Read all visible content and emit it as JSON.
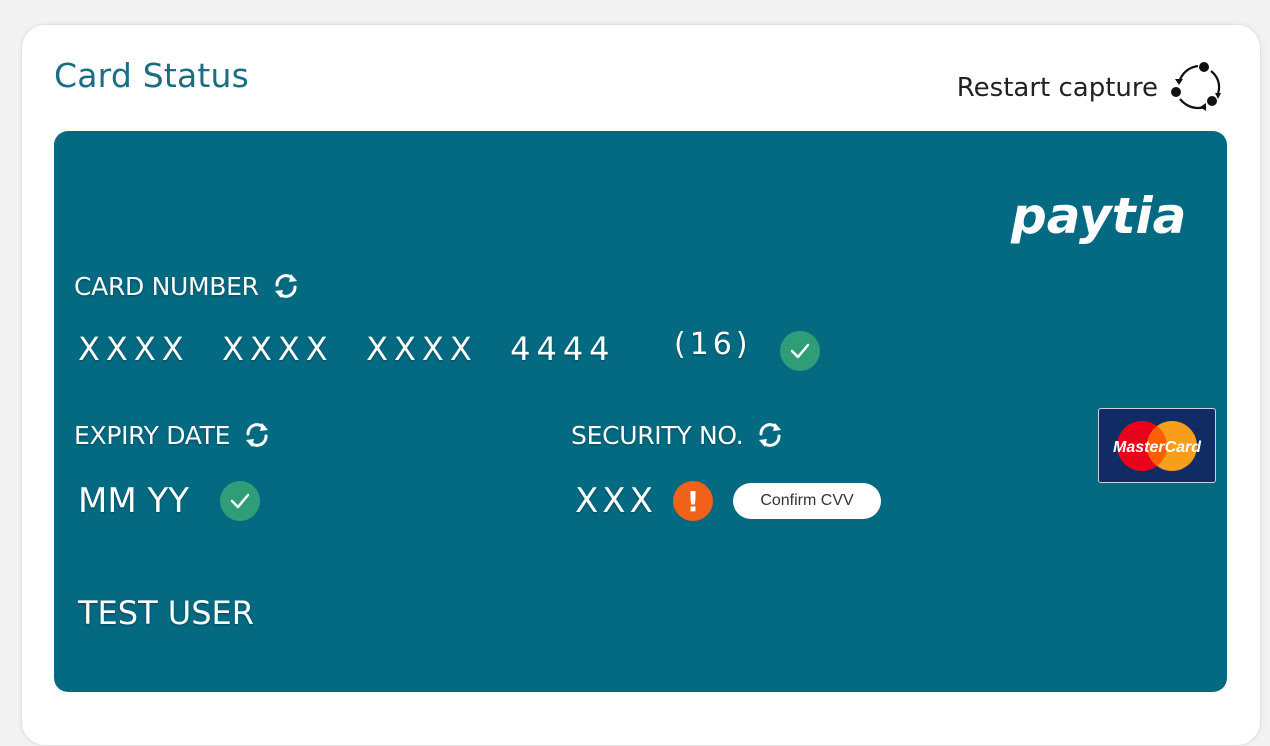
{
  "page": {
    "title": "Card Status"
  },
  "header": {
    "restart_label": "Restart capture",
    "restart_icon": "restart-arrows-icon"
  },
  "card": {
    "brand": "paytia",
    "card_number_label": "CARD NUMBER",
    "card_number_value": "XXXX  XXXX  XXXX  4444",
    "card_number_count": "(16)",
    "card_number_status": "valid",
    "expiry_label": "EXPIRY DATE",
    "expiry_value": "MM YY",
    "expiry_status": "valid",
    "security_label": "SECURITY NO.",
    "security_value": "XXX",
    "security_status": "warning",
    "confirm_cvv_label": "Confirm CVV",
    "cardholder_name": "TEST USER",
    "network_logo": "MasterCard"
  },
  "colors": {
    "title": "#1a6e82",
    "card_background": "#046a82",
    "valid": "#2f9e78",
    "warning": "#f06119",
    "mastercard_red": "#eb001b",
    "mastercard_yellow": "#f79e1b",
    "mastercard_bg": "#112c64"
  }
}
